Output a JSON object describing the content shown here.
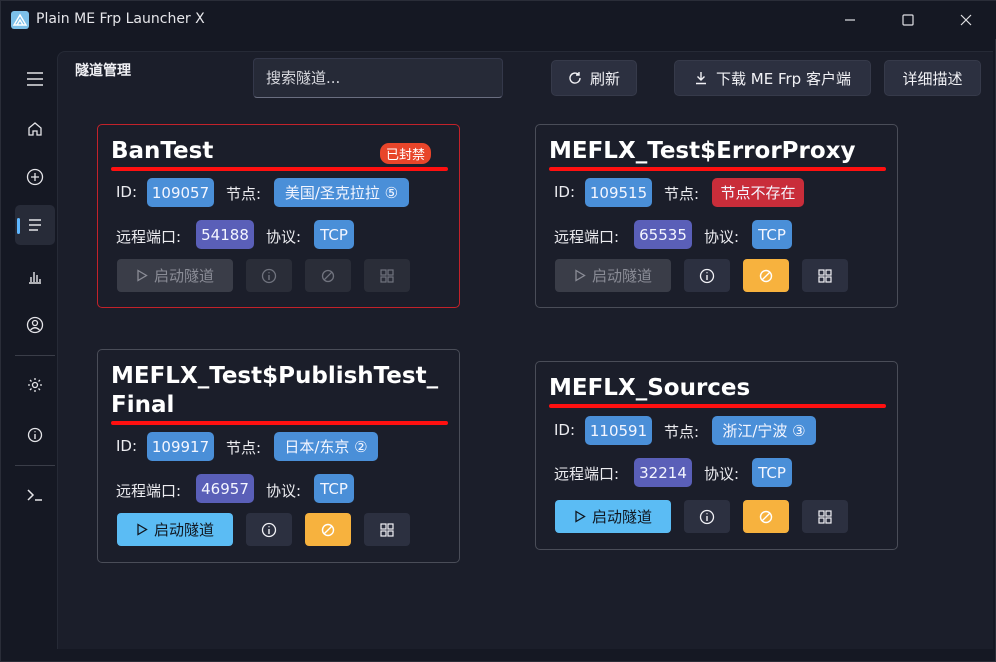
{
  "window": {
    "title": "Plain ME Frp Launcher X",
    "controls": [
      "minimize-icon",
      "maximize-icon",
      "close-icon"
    ]
  },
  "sidebar": {
    "items": [
      {
        "icon": "hamburger-menu-icon"
      },
      {
        "icon": "home-icon"
      },
      {
        "icon": "add-circle-icon"
      },
      {
        "icon": "list-icon",
        "active": true
      },
      {
        "icon": "bar-chart-icon"
      },
      {
        "icon": "user-icon"
      },
      {
        "icon": "gear-icon"
      },
      {
        "icon": "info-icon"
      },
      {
        "icon": "terminal-icon"
      }
    ]
  },
  "header": {
    "title": "隧道管理",
    "search_placeholder": "搜索隧道...",
    "refresh_label": "刷新",
    "download_label": "下载 ME Frp 客户端",
    "details_label": "详细描述"
  },
  "labels": {
    "id": "ID:",
    "node": "节点:",
    "remote_port": "远程端口:",
    "protocol": "协议:",
    "start": "启动隧道"
  },
  "colors": {
    "accent": "#5bbcf4",
    "banned_border": "#c2222a",
    "underline": "#ff1010",
    "warning": "#f7b23e",
    "chip_blue": "#4a8fd8",
    "chip_purple": "#5a5fb8",
    "chip_red": "#c92d3a"
  },
  "tunnels": [
    {
      "name": "BanTest",
      "badge": "已封禁",
      "id": "109057",
      "node": "美国/圣克拉拉 ⑤",
      "remote_port": "54188",
      "protocol": "TCP",
      "state": "banned"
    },
    {
      "name": "MEFLX_Test$ErrorProxy",
      "id": "109515",
      "node": "节点不存在",
      "remote_port": "65535",
      "protocol": "TCP",
      "state": "error"
    },
    {
      "name": "MEFLX_Test$PublishTest_Final",
      "id": "109917",
      "node": "日本/东京 ②",
      "remote_port": "46957",
      "protocol": "TCP",
      "state": "normal"
    },
    {
      "name": "MEFLX_Sources",
      "id": "110591",
      "node": "浙江/宁波 ③",
      "remote_port": "32214",
      "protocol": "TCP",
      "state": "normal"
    }
  ]
}
